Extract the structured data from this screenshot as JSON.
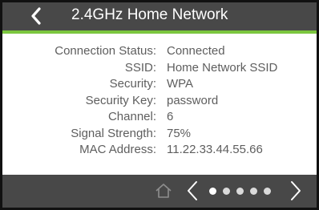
{
  "header": {
    "title": "2.4GHz Home Network",
    "back_icon": "chevron-left-icon"
  },
  "colors": {
    "header_bg": "#484848",
    "accent": "#7bc63e",
    "text": "#5e5e5e"
  },
  "details": [
    {
      "label": "Connection Status:",
      "value": "Connected"
    },
    {
      "label": "SSID:",
      "value": "Home Network SSID"
    },
    {
      "label": "Security:",
      "value": "WPA"
    },
    {
      "label": "Security Key:",
      "value": "password"
    },
    {
      "label": "Channel:",
      "value": "6"
    },
    {
      "label": "Signal Strength:",
      "value": "75%"
    },
    {
      "label": "MAC Address:",
      "value": "11.22.33.44.55.66"
    }
  ],
  "footer": {
    "home_icon": "home-icon",
    "prev_icon": "chevron-left-icon",
    "next_icon": "chevron-right-icon",
    "page_count": 5,
    "current_page": 1
  }
}
